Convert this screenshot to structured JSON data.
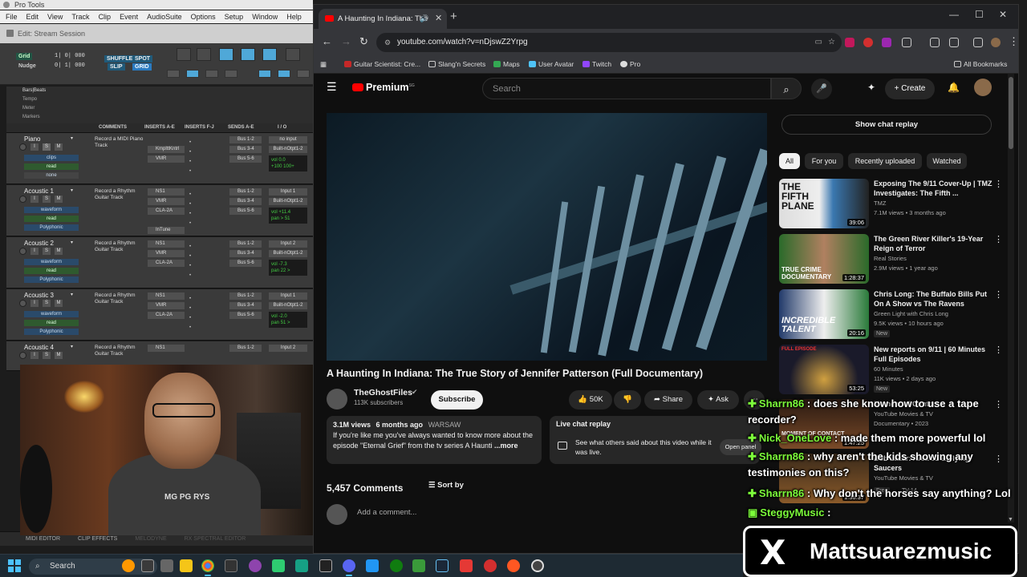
{
  "protools": {
    "title": "Pro Tools",
    "menu": [
      "File",
      "Edit",
      "View",
      "Track",
      "Clip",
      "Event",
      "AudioSuite",
      "Options",
      "Setup",
      "Window",
      "Help"
    ],
    "session_title": "Edit: Stream Session",
    "grid_label": "Grid",
    "nudge_label": "Nudge",
    "grid_value": "1| 0| 000",
    "nudge_value": "0| 1| 000",
    "modes": {
      "shuffle": "SHUFFLE",
      "spot": "SPOT",
      "slip": "SLIP",
      "grid": "GRID"
    },
    "rulers": [
      "Bars|Beats",
      "Tempo",
      "Meter",
      "Markers"
    ],
    "columns": {
      "comments": "COMMENTS",
      "inserts_ae": "INSERTS A-E",
      "inserts_fj": "INSERTS F-J",
      "sends_ae": "SENDS A-E",
      "io": "I / O"
    },
    "tracks": [
      {
        "name": "Piano",
        "comment": "Record a MIDI Piano Track",
        "inserts": [
          "KmplttKntrl",
          "VMR"
        ],
        "sends": [
          "Bus 1-2",
          "Bus 3-4",
          "Bus 5-6"
        ],
        "io": [
          "no input",
          "Built-nOtpt1-2"
        ],
        "vol": "vol 0.0",
        "pan": "+100 100+",
        "view": "clips",
        "auto": "read",
        "extra": "none"
      },
      {
        "name": "Acoustic 1",
        "comment": "Record a Rhythm Guitar Track",
        "inserts": [
          "NS1",
          "VMR",
          "CLA-2A",
          "",
          "InTune"
        ],
        "sends": [
          "Bus 1-2",
          "Bus 3-4",
          "Bus 5-6"
        ],
        "io": [
          "Input 1",
          "Built-nOtpt1-2"
        ],
        "vol": "vol +11.4",
        "pan": "pan > 51",
        "view": "waveform",
        "auto": "read",
        "extra": "Polyphonic"
      },
      {
        "name": "Acoustic 2",
        "comment": "Record a Rhythm Guitar Track",
        "inserts": [
          "NS1",
          "VMR",
          "CLA-2A"
        ],
        "sends": [
          "Bus 1-2",
          "Bus 3-4",
          "Bus 5-6"
        ],
        "io": [
          "Input 2",
          "Built-nOtpt1-2"
        ],
        "vol": "vol -7.3",
        "pan": "pan 22 >",
        "view": "waveform",
        "auto": "read",
        "extra": "Polyphonic"
      },
      {
        "name": "Acoustic 3",
        "comment": "Record a Rhythm Guitar Track",
        "inserts": [
          "NS1",
          "VMR",
          "CLA-2A"
        ],
        "sends": [
          "Bus 1-2",
          "Bus 3-4",
          "Bus 5-6"
        ],
        "io": [
          "Input 1",
          "Built-nOtpt1-2"
        ],
        "vol": "vol -2.0",
        "pan": "pan 51 >",
        "view": "waveform",
        "auto": "read",
        "extra": "Polyphonic"
      },
      {
        "name": "Acoustic 4",
        "comment": "Record a Rhythm Guitar Track",
        "inserts": [
          "NS1"
        ],
        "sends": [
          "Bus 1-2"
        ],
        "io": [
          "Input 2"
        ],
        "vol": "",
        "pan": "",
        "view": "",
        "auto": "",
        "extra": ""
      }
    ],
    "bottom_tabs": [
      "MIDI EDITOR",
      "CLIP EFFECTS",
      "MELODYNE",
      "RX SPECTRAL EDITOR"
    ]
  },
  "webcam": {
    "shirt_text": "MG PG RYS"
  },
  "browser": {
    "tab_title": "A Haunting In Indiana: The",
    "url": "youtube.com/watch?v=nDjswZ2Yrpg",
    "bookmarks": [
      "Guitar Scientist: Cre...",
      "Slang'n Secrets",
      "Maps",
      "User Avatar",
      "Twitch",
      "Pro"
    ],
    "all_bookmarks": "All Bookmarks",
    "colors": {
      "accent_red": "#ff0000",
      "ui_bg": "#0f0f0f"
    }
  },
  "youtube": {
    "logo": "Premium",
    "logo_sup": "SG",
    "search_placeholder": "Search",
    "create_label": "Create",
    "video_title": "A Haunting In Indiana: The True Story of Jennifer Patterson (Full Documentary)",
    "channel": "TheGhostFiles",
    "subscribers": "113K subscribers",
    "subscribe_label": "Subscribe",
    "likes": "50K",
    "share_label": "Share",
    "ask_label": "Ask",
    "description": {
      "views": "3.1M views",
      "age": "6 months ago",
      "tag": "WARSAW",
      "text": "If you're like me you've always wanted to know more about the episode \"Eternal Grief\" from the tv series A Haunti",
      "more": "...more"
    },
    "live_chat": {
      "title": "Live chat replay",
      "desc": "See what others said about this video while it was live.",
      "open": "Open panel"
    },
    "comments_count": "5,457 Comments",
    "sort_label": "Sort by",
    "add_comment": "Add a comment...",
    "show_chat_replay": "Show chat replay",
    "chips": [
      "All",
      "For you",
      "Recently uploaded",
      "Watched"
    ],
    "recommendations": [
      {
        "title": "Exposing The 9/11 Cover-Up | TMZ Investigates: The Fifth ...",
        "channel": "TMZ",
        "meta": "7.1M views • 3 months ago",
        "duration": "39:06",
        "thumb_text": "THE FIFTH PLANE"
      },
      {
        "title": "The Green River Killer's 19-Year Reign of Terror",
        "channel": "Real Stories",
        "meta": "2.9M views • 1 year ago",
        "duration": "1:28:37",
        "thumb_text": "TRUE CRIME DOCUMENTARY"
      },
      {
        "title": "Chris Long: The Buffalo Bills Put On A Show vs The Ravens",
        "channel": "Green Light with Chris Long",
        "meta": "9.5K views • 10 hours ago",
        "duration": "20:16",
        "badge": "New",
        "thumb_text": "INCREDIBLE TALENT"
      },
      {
        "title": "New reports on 9/11 | 60 Minutes Full Episodes",
        "channel": "60 Minutes",
        "meta": "11K views • 2 days ago",
        "duration": "53:25",
        "badge": "New",
        "thumb_text": "FULL EPISODE"
      },
      {
        "title": "Moment of Contact",
        "channel": "YouTube Movies & TV",
        "meta": "Documentary • 2023",
        "duration": "1:47:25",
        "thumb_text": "MOMENT OF CONTACT"
      },
      {
        "title": "Bob Lazar: Area 51 & Flying Saucers",
        "channel": "YouTube Movies & TV",
        "meta": "",
        "duration": "1:36:37",
        "badge": "Free",
        "badge2": "TV-14",
        "thumb_text": ""
      }
    ]
  },
  "overlay_chat": [
    {
      "user": "Sharrn86",
      "msg": " : does she know how to use a tape recorder?"
    },
    {
      "user": "Nick_OneLove",
      "msg": " : made them more powerful lol"
    },
    {
      "user": "Sharrn86",
      "msg": " : why aren't the kids showing any testimonies on this?"
    },
    {
      "user": "Sharrn86",
      "msg": " : Why don't the horses say anything? Lol"
    },
    {
      "user": "SteggyMusic",
      "msg": " :"
    }
  ],
  "brand": {
    "handle": "Mattsuarezmusic",
    "x_logo": "X"
  },
  "taskbar": {
    "search": "Search"
  }
}
